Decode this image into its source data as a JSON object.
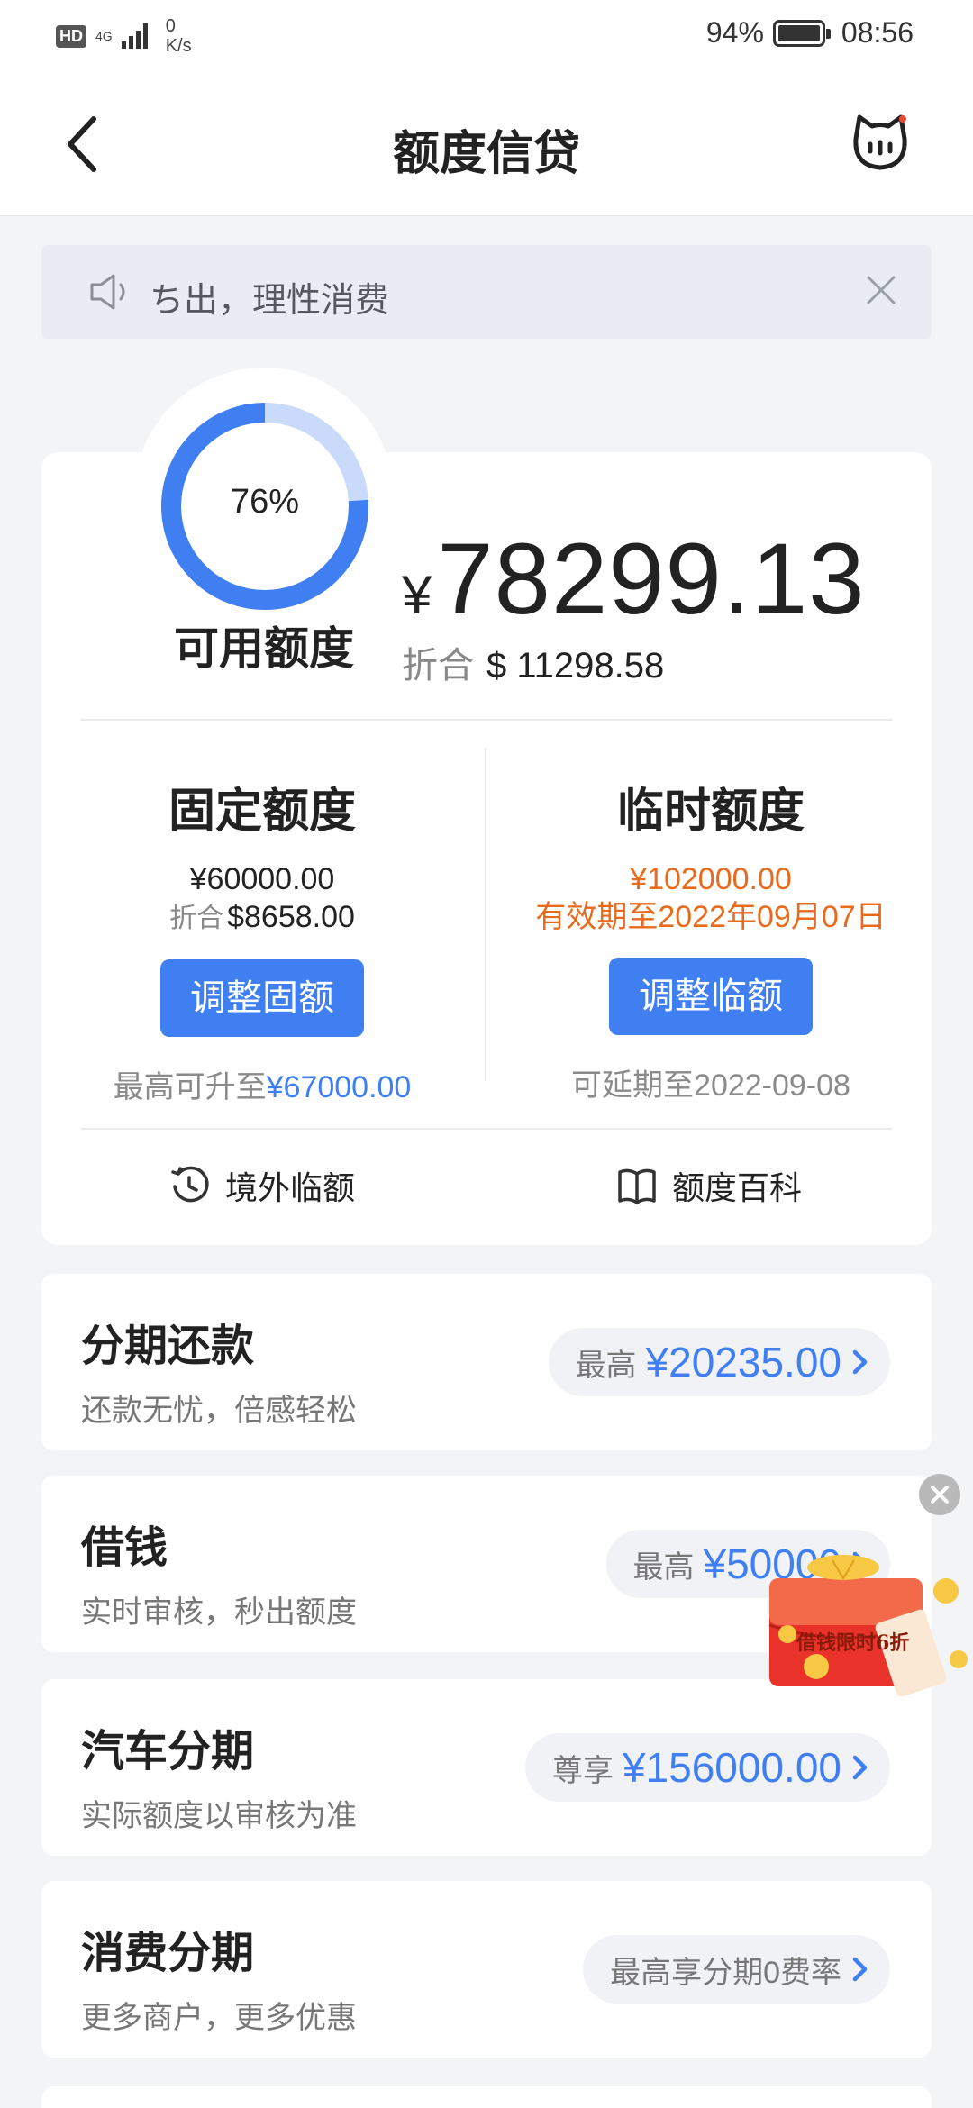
{
  "status_bar": {
    "hd": "HD",
    "network": "4G",
    "speed_value": "0",
    "speed_unit": "K/s",
    "battery": "94%",
    "time": "08:56"
  },
  "header": {
    "title": "额度信贷"
  },
  "notice": {
    "text": "ち出，理性消费"
  },
  "quota": {
    "percent_label": "76%",
    "percent_value": 0.76,
    "available_label": "可用额度",
    "currency_symbol": "¥",
    "available_amount": "78299.13",
    "usd_prefix": "折合",
    "usd_amount": "$ 11298.58",
    "fixed": {
      "title": "固定额度",
      "amount": "¥60000.00",
      "usd_prefix": "折合",
      "usd_amount": "$8658.00",
      "button": "调整固额",
      "foot_prefix": "最高可升至",
      "foot_amount": "¥67000.00"
    },
    "temporary": {
      "title": "临时额度",
      "amount": "¥102000.00",
      "validity": "有效期至2022年09月07日",
      "button": "调整临额",
      "foot": "可延期至2022-09-08"
    },
    "links": {
      "overseas": "境外临额",
      "encyclopedia": "额度百科"
    }
  },
  "services": [
    {
      "title": "分期还款",
      "subtitle": "还款无忧，倍感轻松",
      "pill_prefix": "最高",
      "pill_amount": "¥20235.00"
    },
    {
      "title": "借钱",
      "subtitle": "实时审核，秒出额度",
      "pill_prefix": "最高",
      "pill_amount": "¥50000"
    },
    {
      "title": "汽车分期",
      "subtitle": "实际额度以审核为准",
      "pill_prefix": "尊享",
      "pill_amount": "¥156000.00"
    },
    {
      "title": "消费分期",
      "subtitle": "更多商户，更多优惠",
      "pill_text": "最高享分期0费率"
    }
  ],
  "promo": {
    "text": "借钱限时6折"
  },
  "colors": {
    "accent_blue": "#3f7ff2",
    "warning_orange": "#e86a1d",
    "gauge_track": "#c9dafb"
  }
}
